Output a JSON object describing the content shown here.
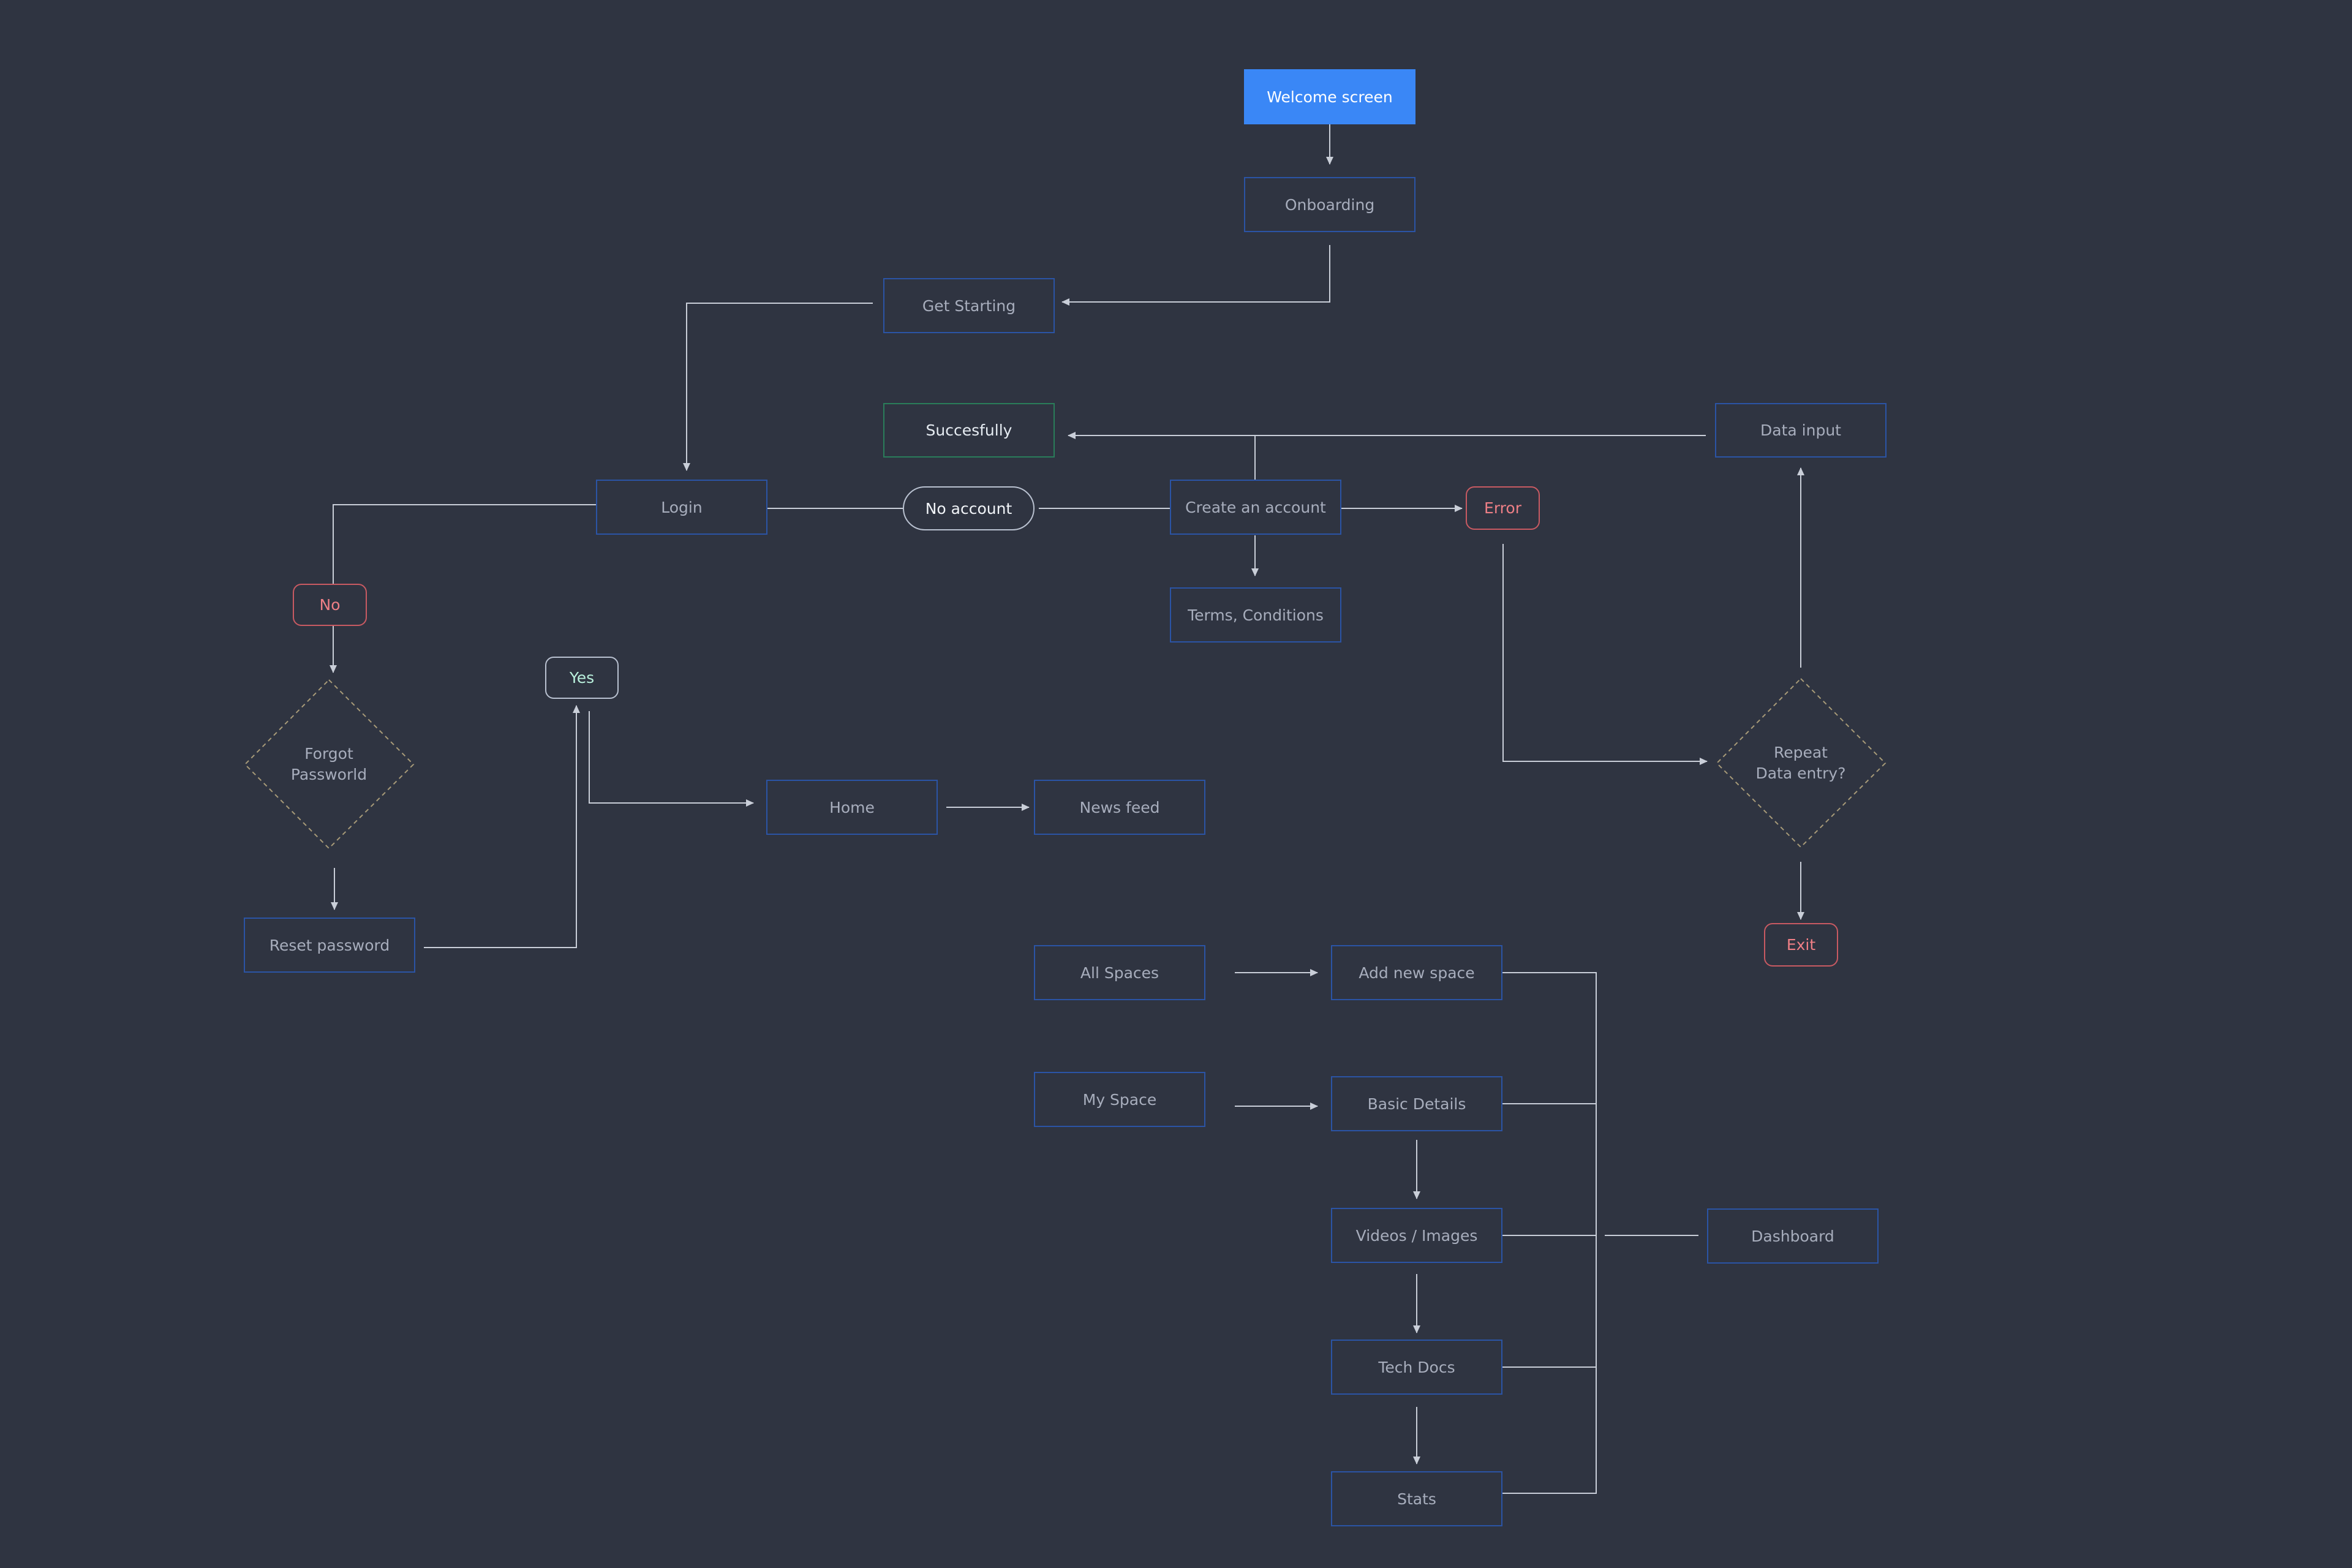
{
  "nodes": {
    "welcome": "Welcome screen",
    "onboarding": "Onboarding",
    "get_starting": "Get Starting",
    "successfully": "Succesfully",
    "data_input": "Data input",
    "login": "Login",
    "no_account": "No account",
    "create_account": "Create an account",
    "error": "Error",
    "terms": "Terms, Conditions",
    "no": "No",
    "yes": "Yes",
    "forgot_password": "Forgot\nPassworld",
    "repeat_entry": "Repeat\nData entry?",
    "home": "Home",
    "news_feed": "News feed",
    "reset_password": "Reset password",
    "exit": "Exit",
    "all_spaces": "All Spaces",
    "add_new_space": "Add new space",
    "my_space": "My Space",
    "basic_details": "Basic Details",
    "videos_images": "Videos / Images",
    "dashboard": "Dashboard",
    "tech_docs": "Tech Docs",
    "stats": "Stats"
  },
  "colors": {
    "background": "#2f3441",
    "connector": "#c9ced8",
    "node_border": "#2b54a5",
    "primary": "#3a87f6",
    "success_border": "#2a7d5a",
    "error": "#c85a62",
    "decision_dash": "#a79a78"
  }
}
